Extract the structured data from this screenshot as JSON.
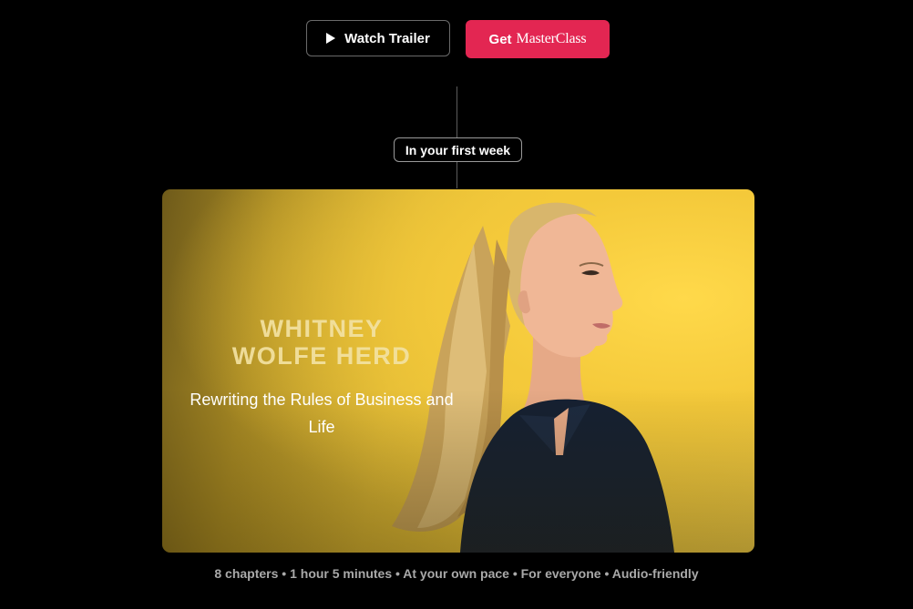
{
  "buttons": {
    "watch_trailer_label": "Watch Trailer",
    "get_label": "Get",
    "brand_label": "MasterClass"
  },
  "timeline": {
    "pill_label": "In your first week"
  },
  "hero": {
    "instructor_name": "WHITNEY\nWOLFE HERD",
    "subtitle": "Rewriting the Rules of Business and Life"
  },
  "meta": {
    "details": "8 chapters • 1 hour 5 minutes • At your own pace • For everyone • Audio-friendly"
  },
  "colors": {
    "accent": "#e32652",
    "background": "#000000",
    "hero_yellow": "#f4c93a",
    "meta_text": "#a9a9a9"
  },
  "icons": {
    "trailer": "play-icon"
  }
}
